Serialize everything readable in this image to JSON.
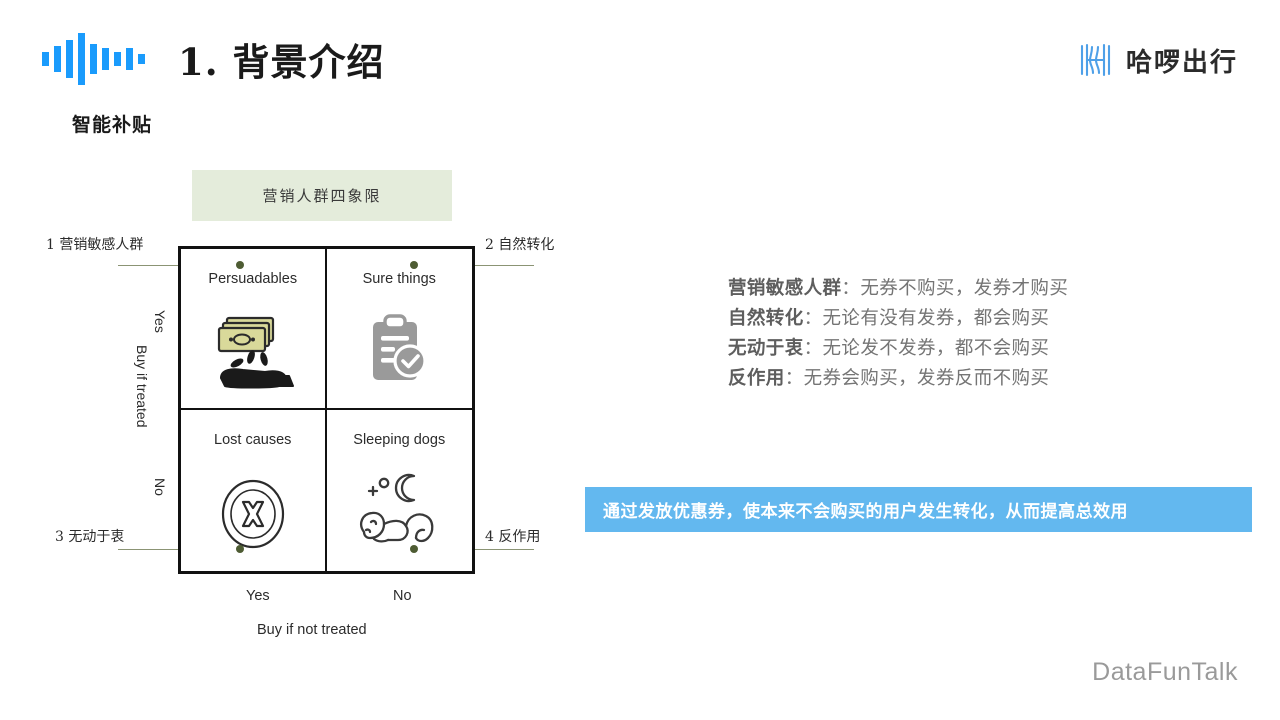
{
  "header": {
    "title": "1. 背景介绍",
    "subtitle": "智能补贴",
    "wave_logo_name": "audio-wave-logo",
    "wave_bar_heights": [
      14,
      26,
      38,
      52,
      30,
      22,
      14,
      22,
      10
    ],
    "wave_color": "#1a9bfc",
    "brand": {
      "mark_name": "hello-h-logo-mark",
      "text": "哈啰出行",
      "mark_color": "#4ea0e8"
    }
  },
  "figure": {
    "caption": "营销人群四象限",
    "caption_bg": "#e4ecdb",
    "quadrants": [
      {
        "key": "q1",
        "label": "Persuadables",
        "icon": "money-in-hand-icon",
        "corner_number": "1",
        "corner_label": "营销敏感人群"
      },
      {
        "key": "q2",
        "label": "Sure things",
        "icon": "clipboard-check-icon",
        "corner_number": "2",
        "corner_label": "自然转化"
      },
      {
        "key": "q3",
        "label": "Lost causes",
        "icon": "circle-x-icon",
        "corner_number": "3",
        "corner_label": "无动于衷"
      },
      {
        "key": "q4",
        "label": "Sleeping dogs",
        "icon": "sleeping-cat-moon-icon",
        "corner_number": "4",
        "corner_label": "反作用"
      }
    ],
    "corner_labels": {
      "c1": "1 营销敏感人群",
      "c2": "2 自然转化",
      "c3": "3 无动于衷",
      "c4": "4 反作用"
    },
    "y_axis": {
      "title": "Buy if treated",
      "ticks": [
        "Yes",
        "No"
      ]
    },
    "x_axis": {
      "title": "Buy if not treated",
      "ticks": [
        "Yes",
        "No"
      ]
    },
    "connector_color": "#8b9474",
    "dot_color": "#4e5c33"
  },
  "definitions": [
    {
      "term": "营销敏感人群",
      "sep": "：",
      "desc": "无券不购买，发券才购买"
    },
    {
      "term": "自然转化",
      "sep": "：",
      "desc": "无论有没有发券，都会购买"
    },
    {
      "term": "无动于衷",
      "sep": "：",
      "desc": "无论发不发券，都不会购买"
    },
    {
      "term": "反作用",
      "sep": "：",
      "desc": "无券会购买，发券反而不购买"
    }
  ],
  "conclusion": {
    "text": "通过发放优惠券，使本来不会购买的用户发生转化，从而提高总效用",
    "bg": "#63b8ef",
    "fg": "#ffffff"
  },
  "watermark": "DataFunTalk"
}
